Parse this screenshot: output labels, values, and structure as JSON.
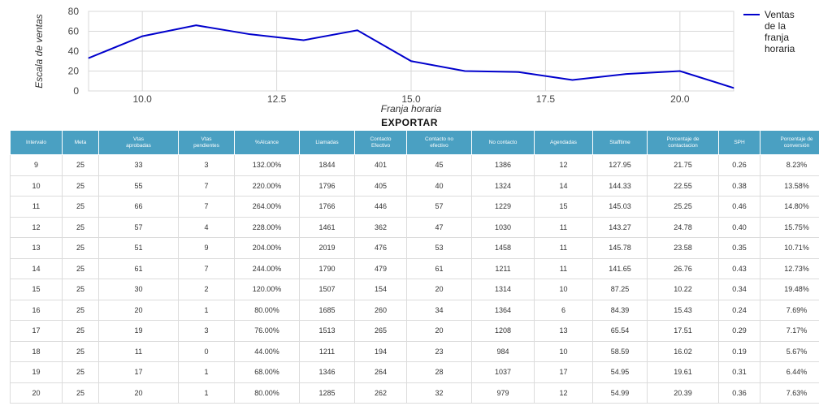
{
  "chart_data": {
    "type": "line",
    "title": "",
    "xlabel": "Franja horaria",
    "ylabel": "Escala de ventas",
    "xlim": [
      9,
      21
    ],
    "ylim": [
      0,
      80
    ],
    "x_ticks": [
      "10.0",
      "12.5",
      "15.0",
      "17.5",
      "20.0"
    ],
    "y_ticks": [
      "0",
      "20",
      "40",
      "60",
      "80"
    ],
    "grid": true,
    "legend_position": "right",
    "series": [
      {
        "name": "Ventas de la franja horaria",
        "color": "#0000cc",
        "x": [
          9,
          10,
          11,
          12,
          13,
          14,
          15,
          16,
          17,
          18,
          19,
          20,
          21
        ],
        "y": [
          33,
          55,
          66,
          57,
          51,
          61,
          30,
          20,
          19,
          11,
          17,
          20,
          3
        ]
      }
    ]
  },
  "legend": {
    "lines": [
      "Ventas",
      "de la",
      "franja",
      "horaria"
    ]
  },
  "export_label": "EXPORTAR",
  "table": {
    "headers": [
      [
        "Intervalo"
      ],
      [
        "Meta"
      ],
      [
        "Vtas",
        "aprobadas"
      ],
      [
        "Vtas",
        "pendientes"
      ],
      [
        "%Alcance"
      ],
      [
        "Llamadas"
      ],
      [
        "Contacto",
        "Efectivo"
      ],
      [
        "Contacto no",
        "efectivo"
      ],
      [
        "No contacto"
      ],
      [
        "Agendadas"
      ],
      [
        "Stafftime"
      ],
      [
        "Porcentaje de",
        "contactacion"
      ],
      [
        "SPH"
      ],
      [
        "Porcentaje de",
        "conversión"
      ]
    ],
    "rows": [
      [
        "9",
        "25",
        "33",
        "3",
        "132.00%",
        "1844",
        "401",
        "45",
        "1386",
        "12",
        "127.95",
        "21.75",
        "0.26",
        "8.23%"
      ],
      [
        "10",
        "25",
        "55",
        "7",
        "220.00%",
        "1796",
        "405",
        "40",
        "1324",
        "14",
        "144.33",
        "22.55",
        "0.38",
        "13.58%"
      ],
      [
        "11",
        "25",
        "66",
        "7",
        "264.00%",
        "1766",
        "446",
        "57",
        "1229",
        "15",
        "145.03",
        "25.25",
        "0.46",
        "14.80%"
      ],
      [
        "12",
        "25",
        "57",
        "4",
        "228.00%",
        "1461",
        "362",
        "47",
        "1030",
        "11",
        "143.27",
        "24.78",
        "0.40",
        "15.75%"
      ],
      [
        "13",
        "25",
        "51",
        "9",
        "204.00%",
        "2019",
        "476",
        "53",
        "1458",
        "11",
        "145.78",
        "23.58",
        "0.35",
        "10.71%"
      ],
      [
        "14",
        "25",
        "61",
        "7",
        "244.00%",
        "1790",
        "479",
        "61",
        "1211",
        "11",
        "141.65",
        "26.76",
        "0.43",
        "12.73%"
      ],
      [
        "15",
        "25",
        "30",
        "2",
        "120.00%",
        "1507",
        "154",
        "20",
        "1314",
        "10",
        "87.25",
        "10.22",
        "0.34",
        "19.48%"
      ],
      [
        "16",
        "25",
        "20",
        "1",
        "80.00%",
        "1685",
        "260",
        "34",
        "1364",
        "6",
        "84.39",
        "15.43",
        "0.24",
        "7.69%"
      ],
      [
        "17",
        "25",
        "19",
        "3",
        "76.00%",
        "1513",
        "265",
        "20",
        "1208",
        "13",
        "65.54",
        "17.51",
        "0.29",
        "7.17%"
      ],
      [
        "18",
        "25",
        "11",
        "0",
        "44.00%",
        "1211",
        "194",
        "23",
        "984",
        "10",
        "58.59",
        "16.02",
        "0.19",
        "5.67%"
      ],
      [
        "19",
        "25",
        "17",
        "1",
        "68.00%",
        "1346",
        "264",
        "28",
        "1037",
        "17",
        "54.95",
        "19.61",
        "0.31",
        "6.44%"
      ],
      [
        "20",
        "25",
        "20",
        "1",
        "80.00%",
        "1285",
        "262",
        "32",
        "979",
        "12",
        "54.99",
        "20.39",
        "0.36",
        "7.63%"
      ]
    ]
  }
}
